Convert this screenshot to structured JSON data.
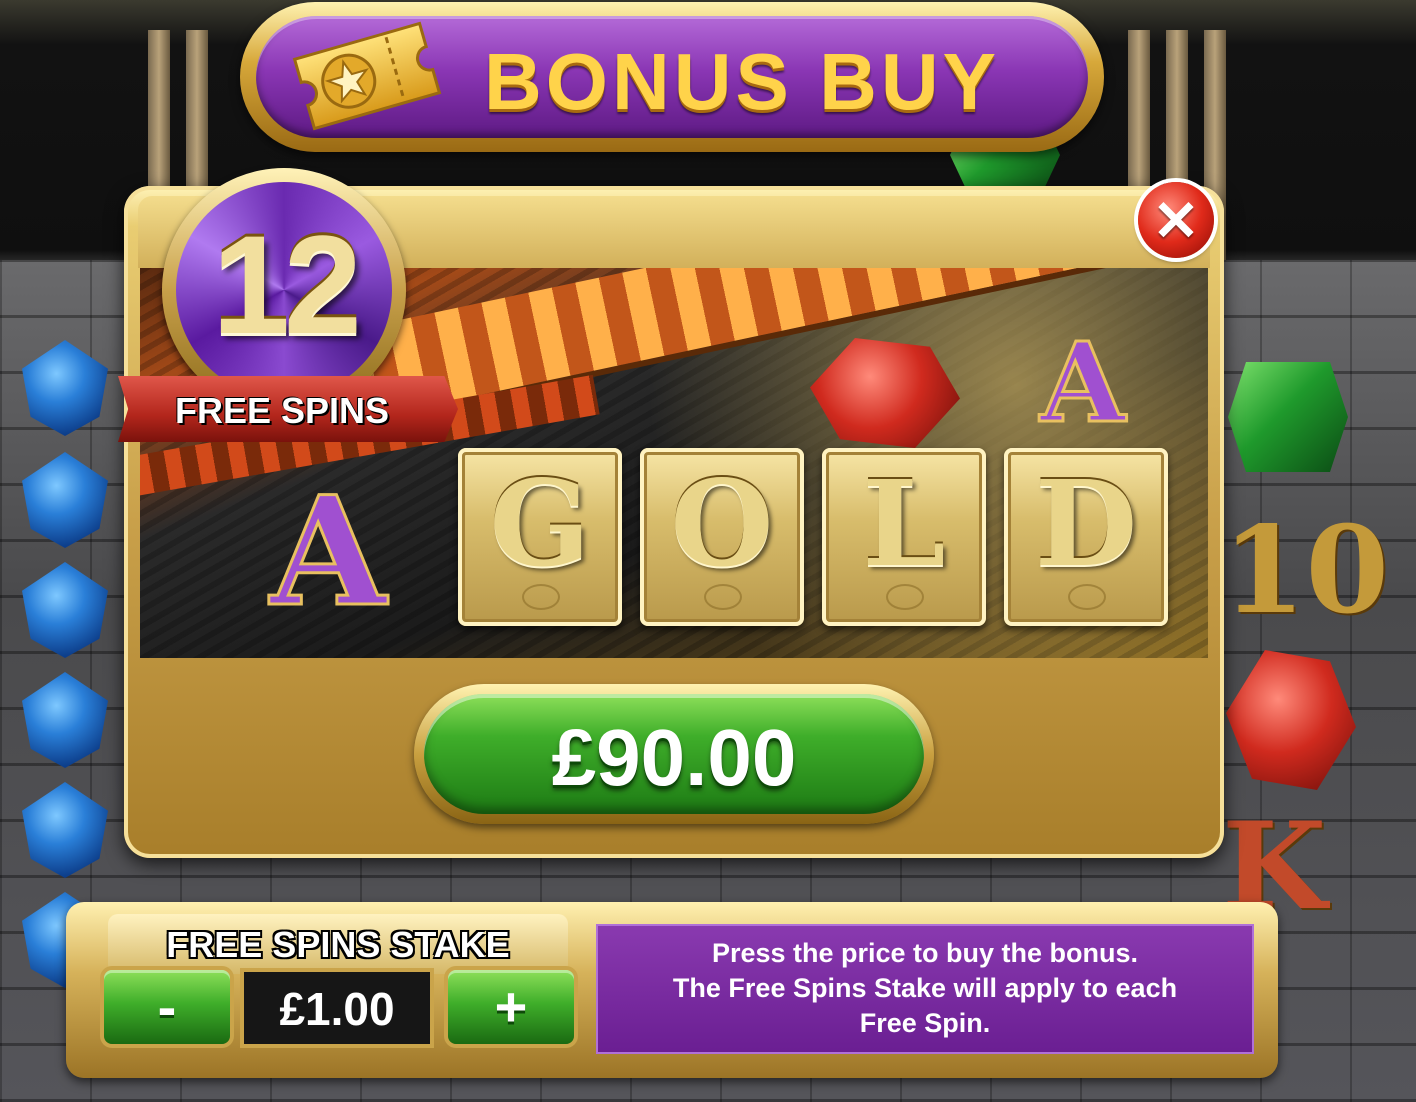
{
  "header": {
    "title": "BONUS BUY",
    "ticket_icon": "ticket-star-icon"
  },
  "offer": {
    "spins_count": "12",
    "spins_label": "FREE SPINS",
    "feature_letters": [
      "G",
      "O",
      "L",
      "D"
    ],
    "price": "£90.00"
  },
  "close_icon": "close-icon",
  "stake": {
    "title": "FREE SPINS STAKE",
    "decrement_label": "-",
    "increment_label": "+",
    "value": "£1.00"
  },
  "info": {
    "lines": [
      "Press the price to buy the bonus.",
      "The Free Spins Stake will apply to each",
      "Free Spin."
    ]
  },
  "colors": {
    "banner_purple": "#8a36b4",
    "title_gold": "#ffd34a",
    "price_green": "#3fae2a",
    "close_red": "#e02a1a",
    "info_purple": "#6a1e92"
  }
}
